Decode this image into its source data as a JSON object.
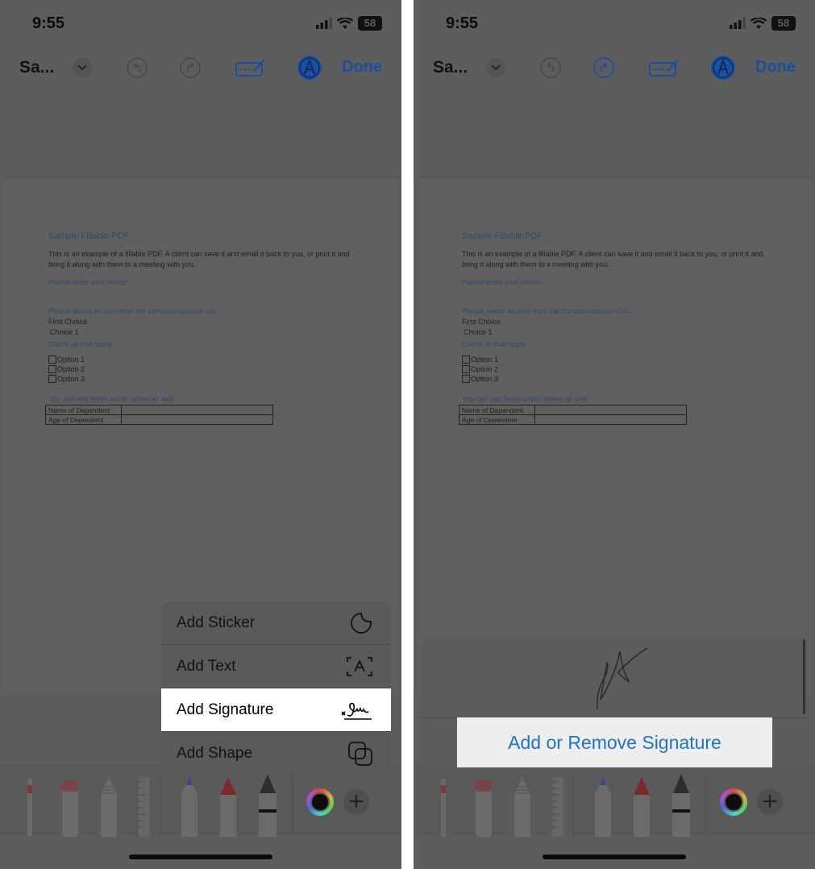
{
  "status": {
    "time": "9:55",
    "battery": "58"
  },
  "toolbar": {
    "doc_title": "Sa...",
    "done_label": "Done"
  },
  "pdf": {
    "title": "Sample Fillable PDF",
    "intro": "This is an example of a fillable PDF. A client can save it and email it back to you, or print it and bring it along with them to a meeting with you.",
    "name_prompt": "Please enter your name:",
    "combo_prompt": "Please select an item from the combo/dropdown list:",
    "first_choice": "First Choice",
    "choice_value": "Choice 1",
    "check_prompt": "Check all that apply:",
    "options": [
      "Option 1",
      "Option 2",
      "Option 3"
    ],
    "table_prompt": "You can add  fields within tables as well:",
    "table_rows": [
      "Name of Dependent",
      "Age of Dependent"
    ]
  },
  "menu": {
    "items": [
      {
        "label": "Add Sticker",
        "icon": "sticker-icon"
      },
      {
        "label": "Add Text",
        "icon": "text-box-icon"
      },
      {
        "label": "Add Signature",
        "icon": "signature-icon"
      },
      {
        "label": "Add Shape",
        "icon": "shapes-icon"
      }
    ]
  },
  "signature_sheet": {
    "add_remove_label": "Add or Remove Signature"
  },
  "colors": {
    "accent_blue": "#1d73cf",
    "done_blue": "#1b4fa0",
    "overlay_grey": "#5d5d5d"
  }
}
